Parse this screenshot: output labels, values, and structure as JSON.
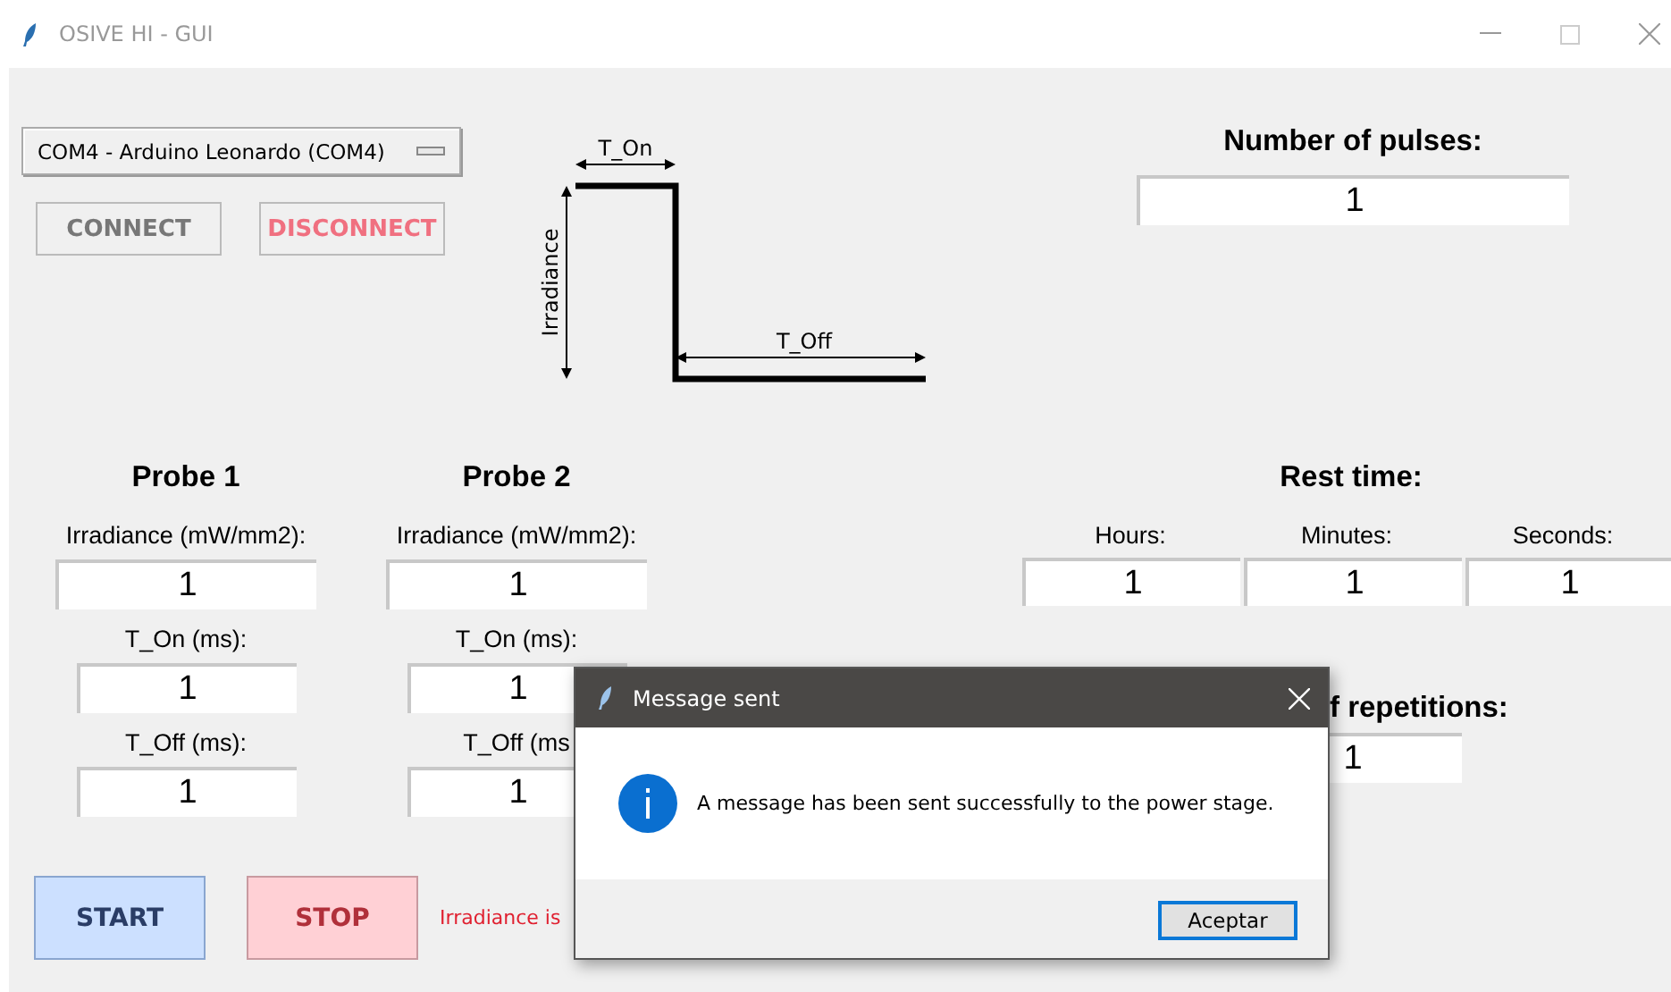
{
  "window": {
    "title": "OSIVE HI - GUI"
  },
  "port_select": {
    "value": "COM4 - Arduino Leonardo (COM4)"
  },
  "connection_buttons": [
    {
      "label": "CONNECT",
      "kind": "connect"
    },
    {
      "label": "DISCONNECT",
      "kind": "disconnect"
    }
  ],
  "diagram": {
    "on_label": "T_On",
    "off_label": "T_Off",
    "axis_label": "Irradiance"
  },
  "pulses": {
    "label": "Number of pulses:",
    "value": "1"
  },
  "probes": [
    {
      "title": "Probe 1",
      "fields": [
        {
          "label": "Irradiance (mW/mm2):",
          "value": "1",
          "kind": "wide"
        },
        {
          "label": "T_On (ms):",
          "value": "1",
          "kind": "narrow"
        },
        {
          "label": "T_Off (ms):",
          "value": "1",
          "kind": "narrow"
        }
      ]
    },
    {
      "title": "Probe 2",
      "fields": [
        {
          "label": "Irradiance (mW/mm2):",
          "value": "1",
          "kind": "wide"
        },
        {
          "label": "T_On (ms):",
          "value": "1",
          "kind": "narrow"
        },
        {
          "label": "T_Off (ms",
          "value": "1",
          "kind": "narrow"
        }
      ]
    }
  ],
  "rest_time": {
    "label": "Rest time:",
    "fields": [
      {
        "label": "Hours:",
        "value": "1"
      },
      {
        "label": "Minutes:",
        "value": "1"
      },
      {
        "label": "Seconds:",
        "value": "1"
      }
    ]
  },
  "repetitions": {
    "label": "f repetitions:",
    "value": "1"
  },
  "actions": [
    {
      "label": "START",
      "kind": "start"
    },
    {
      "label": "STOP",
      "kind": "stop"
    }
  ],
  "status": "Irradiance is",
  "dialog": {
    "title": "Message sent",
    "message": "A message has been sent successfully to the power stage.",
    "button": "Aceptar"
  }
}
